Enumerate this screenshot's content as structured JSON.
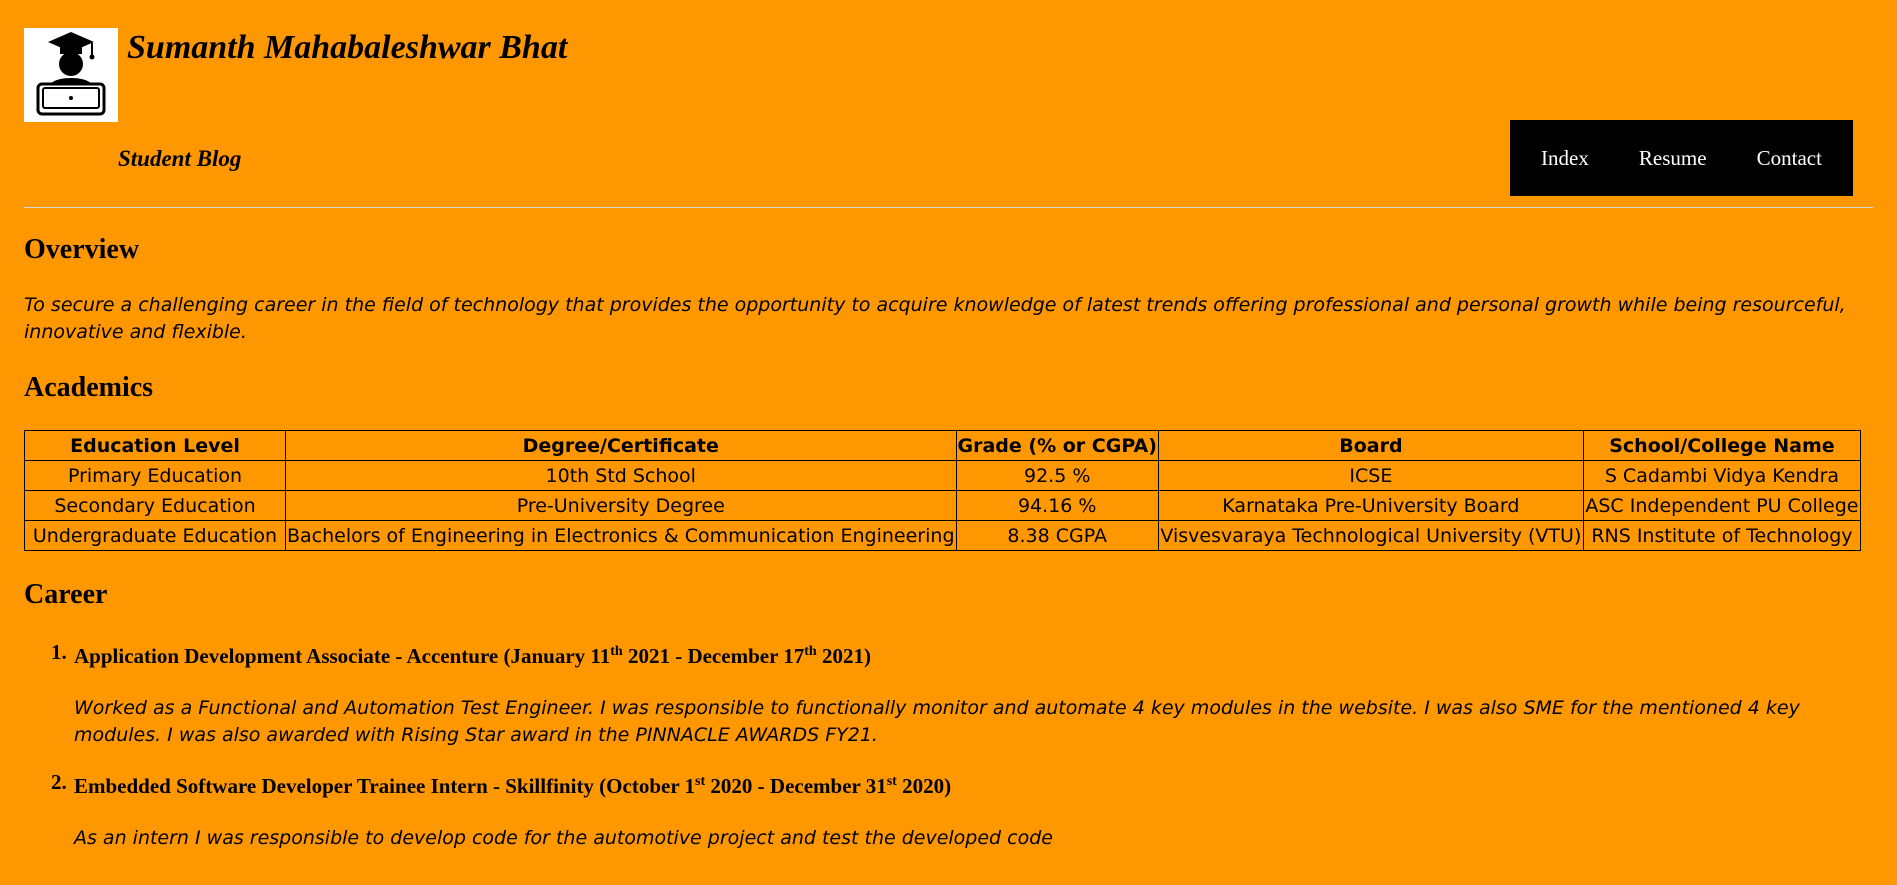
{
  "header": {
    "title": "Sumanth Mahabaleshwar Bhat",
    "tagline": "Student Blog",
    "logo_icon": "graduate-laptop-icon"
  },
  "nav": {
    "items": [
      {
        "label": "Index"
      },
      {
        "label": "Resume"
      },
      {
        "label": "Contact"
      }
    ]
  },
  "overview": {
    "heading": "Overview",
    "text": "To secure a challenging career in the field of technology that provides the opportunity to acquire knowledge of latest trends offering professional and personal growth while being resourceful, innovative and flexible."
  },
  "academics": {
    "heading": "Academics",
    "columns": [
      "Education Level",
      "Degree/Certificate",
      "Grade (% or CGPA)",
      "Board",
      "School/College Name"
    ],
    "rows": [
      [
        "Primary Education",
        "10th Std School",
        "92.5 %",
        "ICSE",
        "S Cadambi Vidya Kendra"
      ],
      [
        "Secondary Education",
        "Pre-University Degree",
        "94.16 %",
        "Karnataka Pre-University Board",
        "ASC Independent PU College"
      ],
      [
        "Undergraduate Education",
        "Bachelors of Engineering in Electronics & Communication Engineering",
        "8.38 CGPA",
        "Visvesvaraya Technological University (VTU)",
        "RNS Institute of Technology"
      ]
    ]
  },
  "career": {
    "heading": "Career",
    "items": [
      {
        "number": "1.",
        "role": "Application Development Associate - Accenture (January 11",
        "sup1": "th",
        "mid": " 2021 - December 17",
        "sup2": "th",
        "end": " 2021)",
        "description": "Worked as a Functional and Automation Test Engineer. I was responsible to functionally monitor and automate 4 key modules in the website. I was also SME for the mentioned 4 key modules. I was also awarded with Rising Star award in the PINNACLE AWARDS FY21."
      },
      {
        "number": "2.",
        "role": "Embedded Software Developer Trainee Intern - Skillfinity (October 1",
        "sup1": "st",
        "mid": " 2020 - December 31",
        "sup2": "st",
        "end": " 2020)",
        "description": "As an intern I was responsible to develop code for the automotive project and test the developed code"
      }
    ]
  }
}
